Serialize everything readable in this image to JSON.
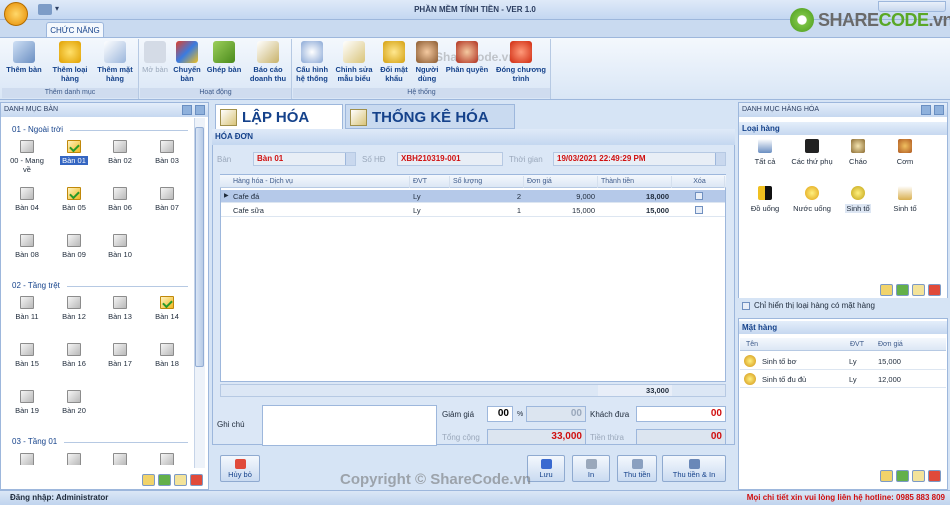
{
  "window": {
    "title": "PHẦN MỀM TÍNH TIỀN - VER 1.0",
    "watermark_top": "ShareCode.vn"
  },
  "brand": {
    "text_a": "SHARE",
    "text_b": "CODE",
    "text_c": ".vn"
  },
  "ribbon": {
    "tab": "CHỨC NĂNG",
    "groups": [
      {
        "label": "Thêm danh mục",
        "buttons": [
          "Thêm bàn",
          "Thêm loại hàng",
          "Thêm mặt hàng"
        ]
      },
      {
        "label": "Hoạt động",
        "buttons": [
          "Mở bàn",
          "Chuyển bàn",
          "Ghép bàn",
          "Báo cáo doanh thu"
        ]
      },
      {
        "label": "Hệ thống",
        "buttons": [
          "Cấu hình hệ thống",
          "Chỉnh sửa mẫu biểu",
          "Đổi mật khẩu",
          "Người dùng",
          "Phân quyền",
          "Đóng chương trình"
        ]
      }
    ]
  },
  "left": {
    "title": "DANH MỤC BÀN",
    "sections": [
      {
        "name": "01 - Ngoài trời",
        "tables": [
          "00 - Mang về",
          "Bàn 01",
          "Bàn 02",
          "Bàn 03",
          "Bàn 04",
          "Bàn 05",
          "Bàn 06",
          "Bàn 07",
          "Bàn 08",
          "Bàn 09",
          "Bàn 10"
        ]
      },
      {
        "name": "02 - Tầng trệt",
        "tables": [
          "Bàn 11",
          "Bàn 12",
          "Bàn 13",
          "Bàn 14",
          "Bàn 15",
          "Bàn 16",
          "Bàn 17",
          "Bàn 18",
          "Bàn 19",
          "Bàn 20"
        ]
      },
      {
        "name": "03 - Tầng 01"
      }
    ]
  },
  "tabs": {
    "invoice": "LẬP HÓA ĐƠN",
    "stats": "THỐNG KÊ HÓA ĐƠN"
  },
  "invoice": {
    "header": "HÓA ĐƠN",
    "table_label": "Bàn",
    "table_value": "Bàn 01",
    "code_label": "Số HĐ",
    "code_value": "XBH210319-001",
    "time_label": "Thời gian",
    "time_value": "19/03/2021 22:49:29 PM",
    "columns": [
      "Hàng hóa - Dịch vụ",
      "ĐVT",
      "Số lượng",
      "Đơn giá",
      "Thành tiền",
      "Xóa"
    ],
    "rows": [
      {
        "item": "Cafe đá",
        "unit": "Ly",
        "qty": "2",
        "price": "9,000",
        "amount": "18,000"
      },
      {
        "item": "Cafe sữa",
        "unit": "Ly",
        "qty": "1",
        "price": "15,000",
        "amount": "15,000"
      }
    ],
    "grid_total": "33,000",
    "note_label": "Ghi chú",
    "discount_label": "Giảm giá",
    "discount_value": "00",
    "discount_pct": "00",
    "pct_sign": "%",
    "total_label": "Tổng cộng",
    "total_value": "33,000",
    "paid_label": "Khách đưa",
    "paid_value": "00",
    "change_label": "Tiền thừa",
    "change_value": "00"
  },
  "actions": {
    "cancel": "Hủy bỏ",
    "save": "Lưu",
    "print": "In",
    "collect": "Thu tiền",
    "collect_print": "Thu tiền & In"
  },
  "right": {
    "title": "DANH MỤC HÀNG HÓA",
    "cat_section": "Loại hàng",
    "categories": [
      "Tất cả",
      "Các thứ phụ",
      "Cháo",
      "Cơm",
      "Đồ uống",
      "Nước uống",
      "Sinh tố",
      "Sinh tố"
    ],
    "filter_label": "Chỉ hiển thị loại hàng có mặt hàng",
    "item_section": "Mặt hàng",
    "item_columns": [
      "Tên",
      "ĐVT",
      "Đơn giá"
    ],
    "items": [
      {
        "name": "Sinh tố bơ",
        "unit": "Ly",
        "price": "15,000"
      },
      {
        "name": "Sinh tố đu đủ",
        "unit": "Ly",
        "price": "12,000"
      }
    ]
  },
  "status": {
    "login": "Đăng nhập: Administrator",
    "hotline": "Mọi chi tiết xin vui lòng liên hệ hotline: 0985 883 809"
  },
  "watermark": "Copyright © ShareCode.vn",
  "colors": {
    "accent": "#15428b",
    "red": "#d01010",
    "selected": "#3566c2"
  }
}
